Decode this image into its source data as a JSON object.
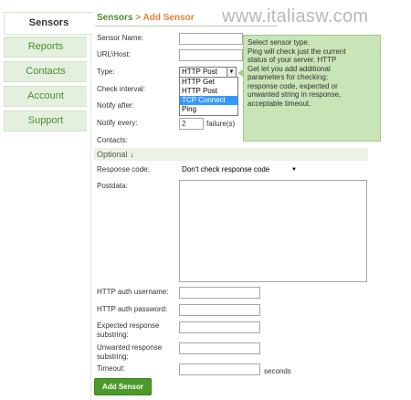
{
  "sidebar": {
    "items": [
      {
        "label": "Sensors",
        "active": true
      },
      {
        "label": "Reports"
      },
      {
        "label": "Contacts"
      },
      {
        "label": "Account"
      },
      {
        "label": "Support"
      }
    ]
  },
  "header": {
    "breadcrumb_root": "Sensors",
    "breadcrumb_sep": ">",
    "breadcrumb_current": "Add Sensor",
    "watermark": "www.italiasw.com"
  },
  "form": {
    "sensor_name_label": "Sensor Name:",
    "sensor_name_value": "",
    "url_host_label": "URL\\Host:",
    "url_host_value": "",
    "type_label": "Type:",
    "type_selected": "HTTP Post",
    "type_options": [
      "HTTP Get",
      "HTTP Post",
      "TCP Connect",
      "Ping"
    ],
    "type_highlighted": "TCP Connect",
    "check_interval_label": "Check interval:",
    "notify_after_label": "Notify after:",
    "notify_every_label": "Notify every:",
    "notify_every_value": "2",
    "notify_every_unit": "failure(s)",
    "contacts_label": "Contacts:",
    "optional_label": "Optional ↓",
    "response_code_label": "Response code:",
    "response_code_selected": "Don't check response code",
    "postdata_label": "Postdata:",
    "http_user_label": "HTTP auth username:",
    "http_pass_label": "HTTP auth password:",
    "expected_label_1": "Expected response",
    "expected_label_2": "substring:",
    "unwanted_label_1": "Unwanted response",
    "unwanted_label_2": "substring:",
    "timeout_label": "Timeout:",
    "timeout_unit": "seconds",
    "submit_label": "Add Sensor"
  },
  "tooltip": {
    "lines": [
      "Select sensor type.",
      "Ping will check just the current",
      "status of your server. HTTP",
      "Get let you add additional",
      "parameters for checking:",
      "response code, expected or",
      "unwanted string in response,",
      "acceptable timeout."
    ]
  },
  "colors": {
    "brand_green": "#4e8a32",
    "accent_orange": "#e08030",
    "tooltip_bg": "#c9e4b7",
    "highlight_blue": "#3399ff",
    "button_green": "#4d9a2c"
  }
}
